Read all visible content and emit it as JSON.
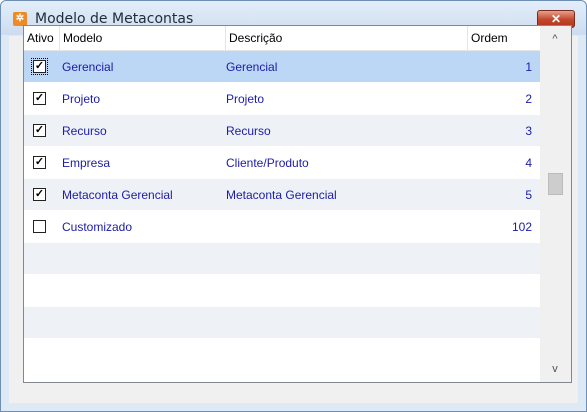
{
  "window": {
    "title": "Modelo de Metacontas",
    "app_icon": "app-logo-icon",
    "close_glyph": "✕"
  },
  "grid": {
    "columns": [
      "Ativo",
      "Modelo",
      "Descrição",
      "Ordem"
    ],
    "rows": [
      {
        "checked": true,
        "modelo": "Gerencial",
        "descricao": "Gerencial",
        "ordem": "1",
        "selected": true
      },
      {
        "checked": true,
        "modelo": "Projeto",
        "descricao": "Projeto",
        "ordem": "2"
      },
      {
        "checked": true,
        "modelo": "Recurso",
        "descricao": "Recurso",
        "ordem": "3"
      },
      {
        "checked": true,
        "modelo": "Empresa",
        "descricao": "Cliente/Produto",
        "ordem": "4"
      },
      {
        "checked": true,
        "modelo": "Metaconta Gerencial",
        "descricao": "Metaconta Gerencial",
        "ordem": "5"
      },
      {
        "checked": false,
        "modelo": "Customizado",
        "descricao": "",
        "ordem": "102"
      }
    ],
    "scroll_up_glyph": "^",
    "scroll_down_glyph": "v"
  },
  "colors": {
    "accent_text": "#1c1ca8",
    "selection": "#bcd7f5",
    "close_button": "#c2452a"
  }
}
